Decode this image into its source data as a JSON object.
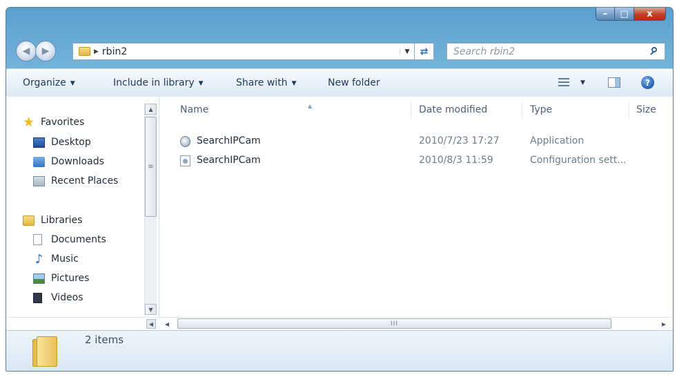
{
  "window": {
    "controls": {
      "minimize": "–",
      "maximize": "□",
      "close": "x"
    }
  },
  "navigation": {
    "back_glyph": "◀",
    "forward_glyph": "▶",
    "path": [
      "rbin2"
    ],
    "refresh_glyph": "⇄",
    "search_placeholder": "Search rbin2"
  },
  "toolbar": {
    "organize_label": "Organize",
    "include_label": "Include in library",
    "share_label": "Share with",
    "new_folder_label": "New folder",
    "icons": [
      "views-icon",
      "preview-pane-icon",
      "help-icon"
    ]
  },
  "nav_pane": {
    "favorites": {
      "label": "Favorites",
      "items": [
        "Desktop",
        "Downloads",
        "Recent Places"
      ]
    },
    "libraries": {
      "label": "Libraries",
      "items": [
        "Documents",
        "Music",
        "Pictures",
        "Videos"
      ]
    }
  },
  "file_list": {
    "columns": [
      "Name",
      "Date modified",
      "Type",
      "Size"
    ],
    "rows": [
      {
        "name": "SearchIPCam",
        "date": "2010/7/23 17:27",
        "type": "Application",
        "icon": "application-icon"
      },
      {
        "name": "SearchIPCam",
        "date": "2010/8/3 11:59",
        "type": "Configuration sett...",
        "icon": "config-file-icon"
      }
    ]
  },
  "scrollbar": {
    "thumb_grip": "≡",
    "h_thumb_grip": "III"
  },
  "details_pane": {
    "item_count": "2 items"
  },
  "colors": {
    "title_bar": "#6fb0d8",
    "close_button": "#c2412a",
    "toolbar": "#e8f0f8",
    "link_text": "#1e3a58"
  }
}
